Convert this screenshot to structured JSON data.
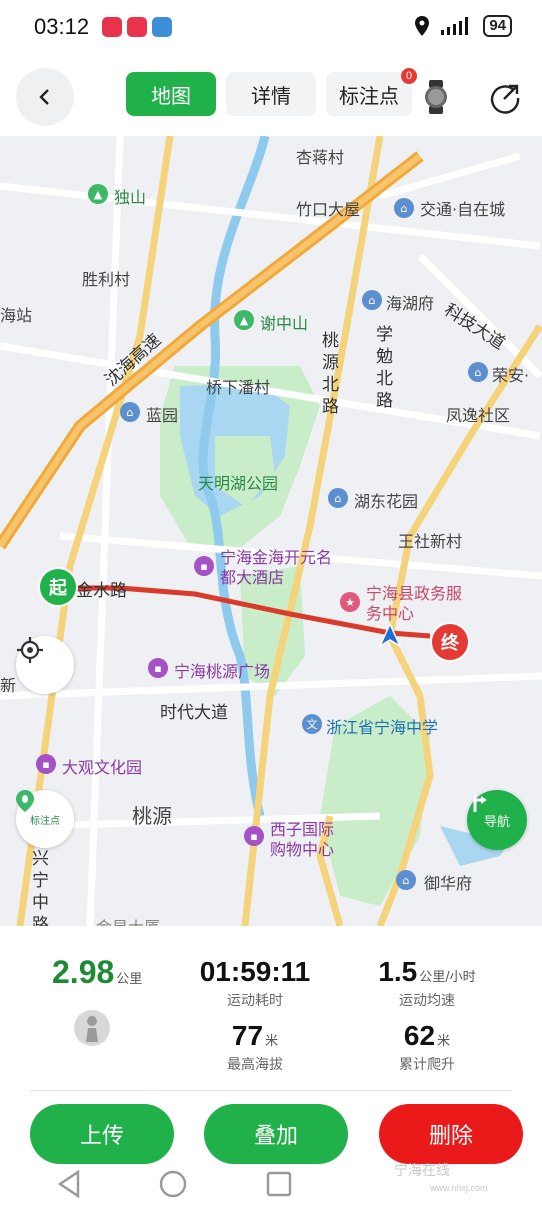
{
  "status_bar": {
    "time": "03:12",
    "battery": "94"
  },
  "tabs": {
    "map": "地图",
    "detail": "详情",
    "marks": "标注点",
    "marks_badge": "0"
  },
  "map": {
    "labels": {
      "xingjiang_village": "杏蒋村",
      "dushan": "独山",
      "zhukou": "竹口大屋",
      "traffic_center": "交通·自在城",
      "shengli": "胜利村",
      "haihufu": "海湖府",
      "kejidadao": "科技大道",
      "station": "海站",
      "shenhai_highway": "沈海高速",
      "xiezhongshan": "谢中山",
      "taoyuan_north": "桃源北路",
      "xuemian_north": "学勉北路",
      "rongan": "荣安·",
      "qiaoxia": "桥下潘村",
      "lanyuan": "蓝园",
      "fengyi": "凤逸社区",
      "tianming_park": "天明湖公园",
      "hudong": "湖东花园",
      "wangshe": "王社新村",
      "hotel": "宁海金海开元名都大酒店",
      "government": "宁海县政务服务中心",
      "jinshui_road": "金水路",
      "taoyuan_plaza": "宁海桃源广场",
      "shidai_avenue": "时代大道",
      "ninghai_middle_school": "浙江省宁海中学",
      "daguan": "大观文化园",
      "taoyuan": "桃源",
      "xizi": "西子国际购物中心",
      "xingning": "兴宁中路",
      "yuhuafu": "御华府",
      "xin": "新",
      "bottom_cut": "金星大厦"
    },
    "start_label": "起",
    "end_label": "终",
    "mark_button_label": "标注点",
    "nav_button_label": "导航",
    "route_color": "#d93a2b"
  },
  "stats": {
    "distance": {
      "value": "2.98",
      "unit": "公里"
    },
    "duration": {
      "value": "01:59:11",
      "label": "运动耗时"
    },
    "avg_speed": {
      "value": "1.5",
      "unit": "公里/小时",
      "label": "运动均速"
    },
    "max_altitude": {
      "value": "77",
      "unit": "米",
      "label": "最高海拔"
    },
    "total_climb": {
      "value": "62",
      "unit": "米",
      "label": "累计爬升"
    }
  },
  "actions": {
    "upload": "上传",
    "overlay": "叠加",
    "delete": "删除"
  },
  "watermark": {
    "line1": "宁海在线",
    "line2": "www.nhxj.com"
  },
  "colors": {
    "primary_green": "#21b14a",
    "delete_red": "#ea1a1a"
  }
}
